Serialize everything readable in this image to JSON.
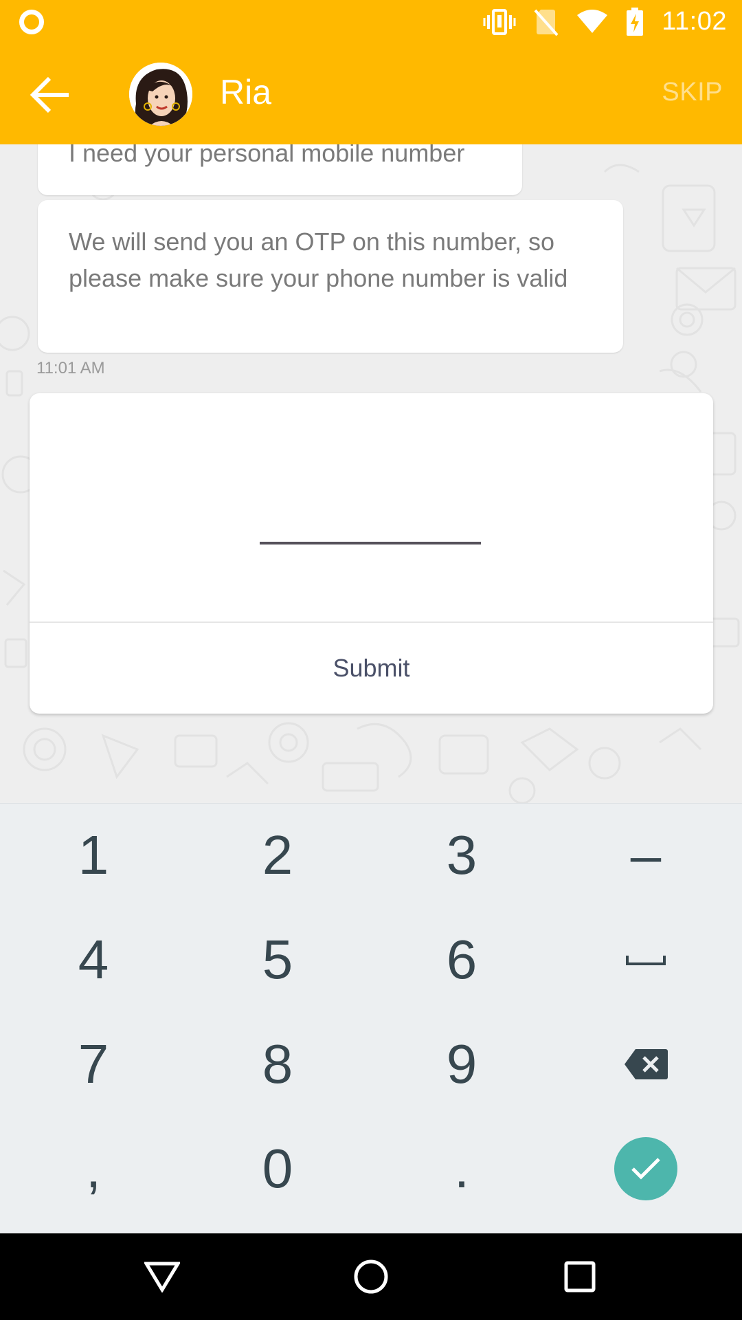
{
  "status_bar": {
    "time": "11:02",
    "icons": [
      "notification-ring-icon",
      "vibrate-icon",
      "no-sim-icon",
      "wifi-icon",
      "battery-charging-icon"
    ]
  },
  "app_bar": {
    "back_icon": "arrow-left-icon",
    "contact_name": "Ria",
    "skip_label": "SKIP"
  },
  "chat": {
    "messages": [
      {
        "text": "I need your personal mobile number"
      },
      {
        "text": "We will send you an OTP on this number, so please make sure your phone number is valid"
      }
    ],
    "timestamp": "11:01 AM"
  },
  "input_card": {
    "phone_value": "",
    "submit_label": "Submit"
  },
  "keyboard": {
    "keys": [
      "1",
      "2",
      "3",
      "–",
      "4",
      "5",
      "6",
      "space",
      "7",
      "8",
      "9",
      "backspace",
      ",",
      "0",
      ".",
      "done"
    ],
    "labels": {
      "k1": "1",
      "k2": "2",
      "k3": "3",
      "dash": "–",
      "k4": "4",
      "k5": "5",
      "k6": "6",
      "k7": "7",
      "k8": "8",
      "k9": "9",
      "comma": ",",
      "k0": "0",
      "period": "."
    },
    "accent_color": "#4DB6AC"
  },
  "nav_bar": {
    "icons": [
      "back-triangle-icon",
      "home-circle-icon",
      "recents-square-icon"
    ]
  },
  "colors": {
    "primary": "#FFB900",
    "chat_background": "#EEEEEE",
    "keyboard_background": "#ECEFF1"
  }
}
